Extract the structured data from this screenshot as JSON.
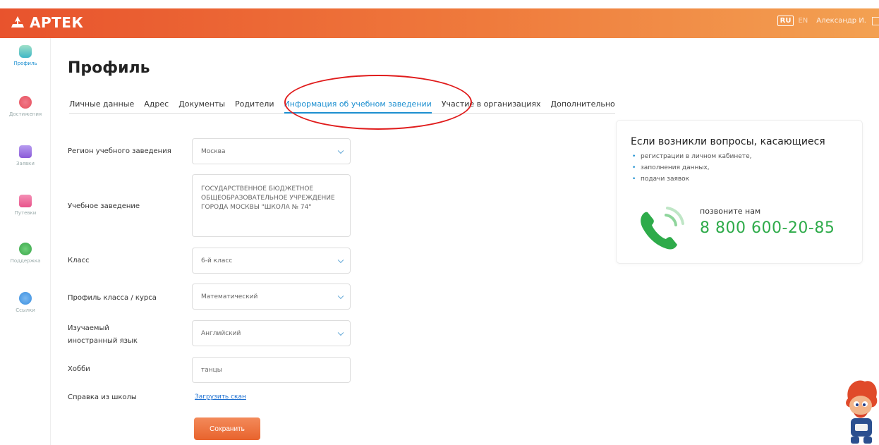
{
  "header": {
    "logo_text": "АРТЕК",
    "lang_ru": "RU",
    "lang_en": "EN",
    "user_name": "Александр И."
  },
  "sidebar": {
    "items": [
      {
        "label": "Профиль",
        "color": "#3fb7c6"
      },
      {
        "label": "Достижения",
        "color": "#e74f5c"
      },
      {
        "label": "Заявки",
        "color": "#8a5bd8"
      },
      {
        "label": "Путевки",
        "color": "#e8538a"
      },
      {
        "label": "Поддержка",
        "color": "#3aa64a"
      },
      {
        "label": "Ссылки",
        "color": "#3b8fe0"
      }
    ]
  },
  "page": {
    "title": "Профиль"
  },
  "tabs": [
    {
      "label": "Личные данные"
    },
    {
      "label": "Адрес"
    },
    {
      "label": "Документы"
    },
    {
      "label": "Родители"
    },
    {
      "label": "Информация об учебном заведении"
    },
    {
      "label": "Участие в организациях"
    },
    {
      "label": "Дополнительно"
    }
  ],
  "form": {
    "region_label": "Регион учебного заведения",
    "region_value": "Москва",
    "school_label": "Учебное заведение",
    "school_value": "ГОСУДАРСТВЕННОЕ БЮДЖЕТНОЕ ОБЩЕОБРАЗОВАТЕЛЬНОЕ УЧРЕЖДЕНИЕ ГОРОДА МОСКВЫ \"ШКОЛА № 74\"",
    "class_label": "Класс",
    "class_value": "6-й класс",
    "profile_label": "Профиль класса / курса",
    "profile_value": "Математический",
    "lang_label_1": "Изучаемый",
    "lang_label_2": "иностранный язык",
    "lang_value": "Английский",
    "hobby_label": "Хобби",
    "hobby_value": "танцы",
    "certificate_label": "Справка из школы",
    "upload_link": "Загрузить скан",
    "save_label": "Сохранить"
  },
  "help": {
    "title": "Если возникли вопросы, касающиеся",
    "items": [
      "регистрации в личном кабинете,",
      "заполнения данных,",
      "подачи заявок"
    ],
    "call_text": "позвоните нам",
    "phone": "8 800 600-20-85"
  },
  "colors": {
    "accent": "#1c8fd0",
    "header_start": "#e8532d",
    "header_end": "#f3a152",
    "phone_green": "#2eab4a",
    "annotation": "#e01c1c"
  }
}
